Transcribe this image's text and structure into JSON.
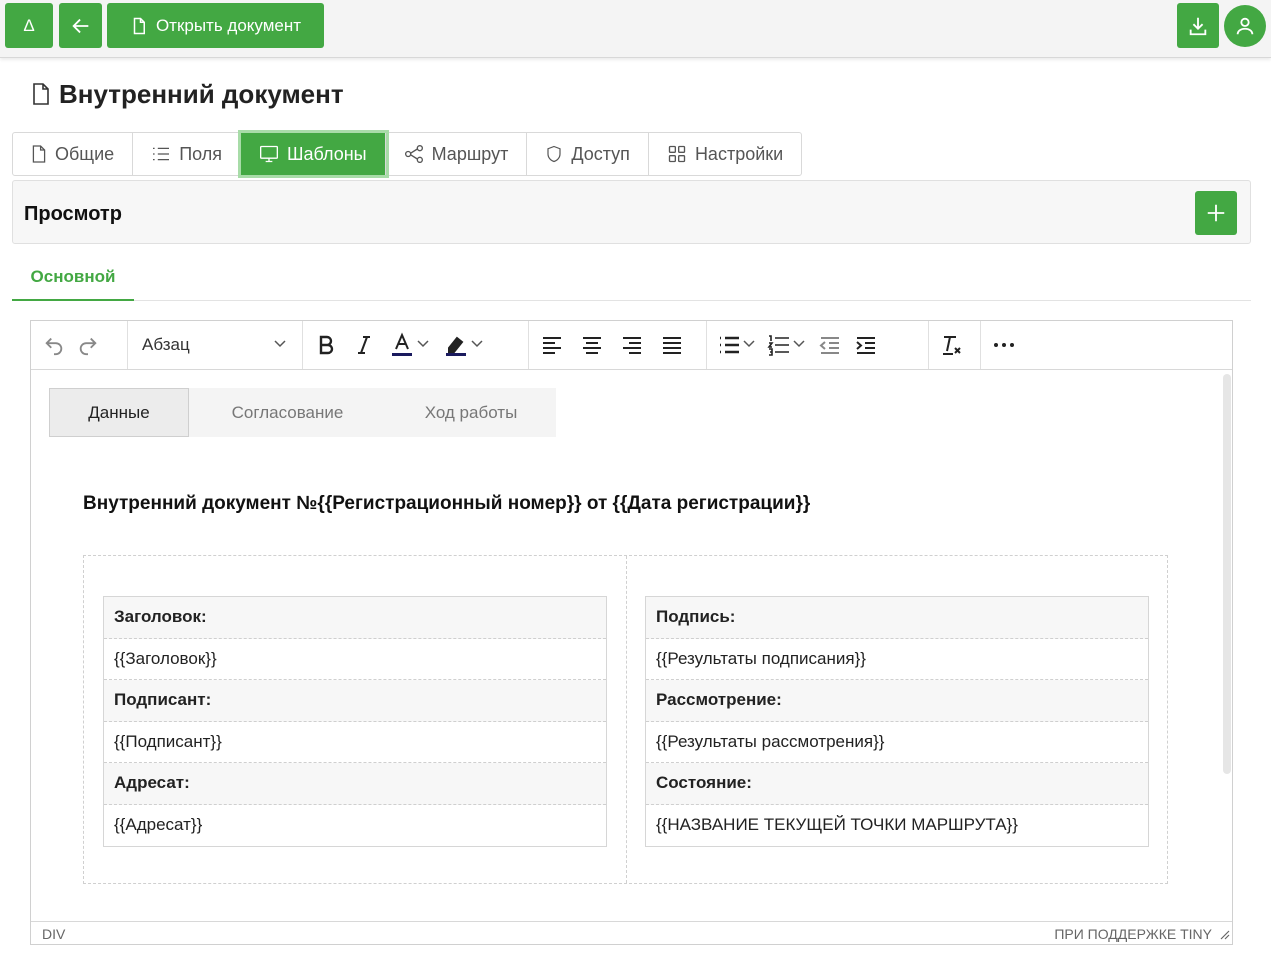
{
  "topbar": {
    "delta_label": "Δ",
    "open_doc_label": "Открыть документ"
  },
  "page": {
    "title": "Внутренний документ"
  },
  "tabs": [
    {
      "label": "Общие",
      "icon": "file-icon"
    },
    {
      "label": "Поля",
      "icon": "list-icon"
    },
    {
      "label": "Шаблоны",
      "icon": "monitor-icon",
      "active": true
    },
    {
      "label": "Маршрут",
      "icon": "share-icon"
    },
    {
      "label": "Доступ",
      "icon": "shield-icon"
    },
    {
      "label": "Настройки",
      "icon": "grid-icon"
    }
  ],
  "preview": {
    "title": "Просмотр",
    "subtab": "Основной"
  },
  "editor": {
    "block_format": "Абзац",
    "status_path": "DIV",
    "status_brand": "ПРИ ПОДДЕРЖКЕ TINY",
    "inner_tabs": [
      "Данные",
      "Согласование",
      "Ход работы"
    ],
    "heading": "Внутренний документ №{{Регистрационный номер}} от {{Дата регистрации}}",
    "left_table": [
      {
        "label": "Заголовок:",
        "value": "{{Заголовок}}"
      },
      {
        "label": "Подписант:",
        "value": "{{Подписант}}"
      },
      {
        "label": "Адресат:",
        "value": "{{Адресат}}"
      }
    ],
    "right_table": [
      {
        "label": "Подпись:",
        "value": "{{Результаты подписания}}"
      },
      {
        "label": "Рассмотрение:",
        "value": "{{Результаты рассмотрения}}"
      },
      {
        "label": "Состояние:",
        "value": "{{НАЗВАНИЕ ТЕКУЩЕЙ ТОЧКИ МАРШРУТА}}"
      }
    ]
  },
  "colors": {
    "accent": "#43a843"
  }
}
